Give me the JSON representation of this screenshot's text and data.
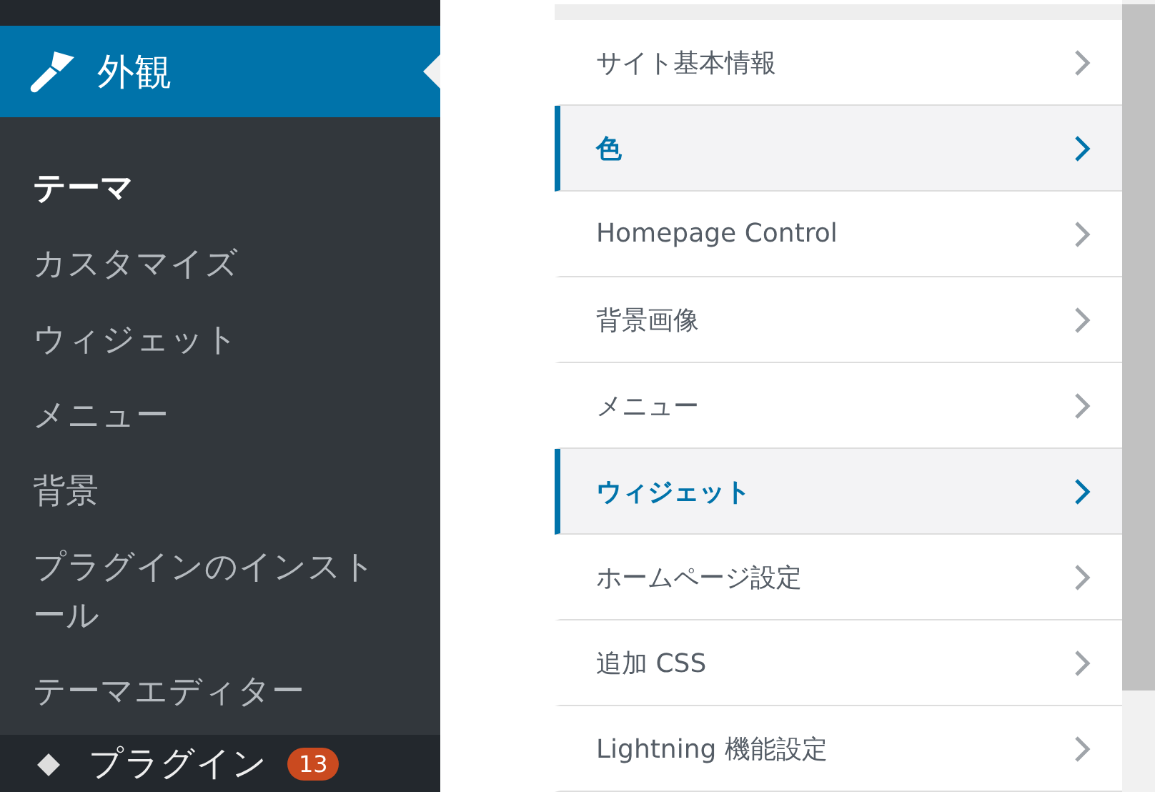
{
  "admin_menu": {
    "section": {
      "label": "外観",
      "selected": true
    },
    "submenu": [
      {
        "label": "テーマ",
        "current": true
      },
      {
        "label": "カスタマイズ",
        "current": false
      },
      {
        "label": "ウィジェット",
        "current": false
      },
      {
        "label": "メニュー",
        "current": false
      },
      {
        "label": "背景",
        "current": false
      },
      {
        "label": "プラグインのインストール",
        "current": false
      },
      {
        "label": "テーマエディター",
        "current": false
      }
    ],
    "next_item": {
      "label": "プラグイン",
      "badge": "13"
    }
  },
  "customizer": {
    "sections": [
      {
        "label": "サイト基本情報",
        "selected": false
      },
      {
        "label": "色",
        "selected": true
      },
      {
        "label": "Homepage Control",
        "selected": false
      },
      {
        "label": "背景画像",
        "selected": false
      },
      {
        "label": "メニュー",
        "selected": false
      },
      {
        "label": "ウィジェット",
        "selected": true
      },
      {
        "label": "ホームページ設定",
        "selected": false
      },
      {
        "label": "追加 CSS",
        "selected": false
      },
      {
        "label": "Lightning 機能設定",
        "selected": false
      }
    ]
  }
}
